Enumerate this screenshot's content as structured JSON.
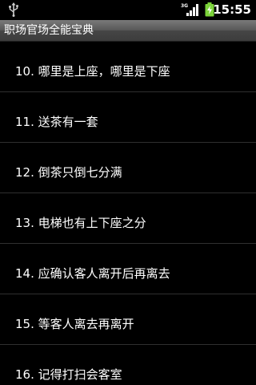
{
  "status_bar": {
    "time": "15:55",
    "signal_label": "3G",
    "icons": [
      "usb-icon",
      "signal-icon",
      "battery-charging-icon"
    ],
    "battery_color": "#7cd43a"
  },
  "title_bar": {
    "title": "职场官场全能宝典"
  },
  "list": {
    "items": [
      {
        "label": "10. 哪里是上座，哪里是下座"
      },
      {
        "label": "11. 送茶有一套"
      },
      {
        "label": "12. 倒茶只倒七分满"
      },
      {
        "label": "13. 电梯也有上下座之分"
      },
      {
        "label": "14. 应确认客人离开后再离去"
      },
      {
        "label": "15. 等客人离去再离开"
      },
      {
        "label": "16. 记得打扫会客室"
      }
    ]
  }
}
